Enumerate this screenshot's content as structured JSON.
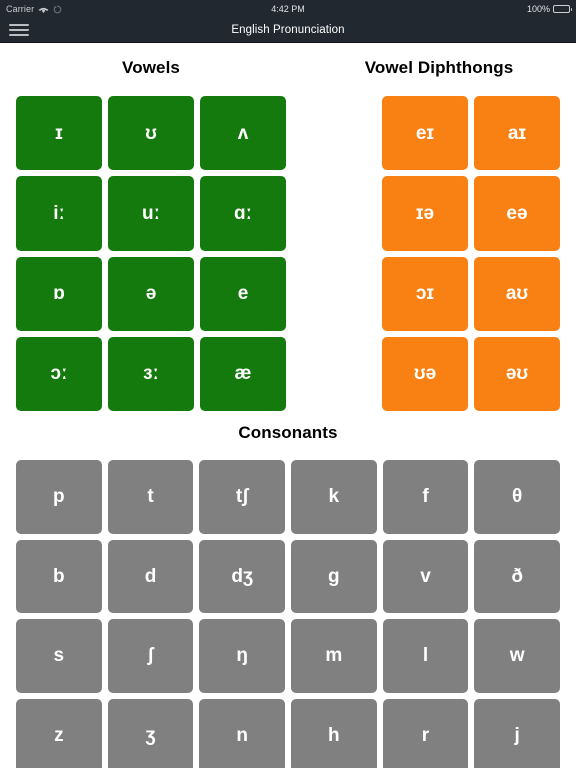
{
  "status_bar": {
    "carrier": "Carrier",
    "wifi_icon": "wifi-icon",
    "sync_icon": "sync-icon",
    "time": "4:42 PM",
    "battery_percent": "100%",
    "battery_icon": "battery-icon"
  },
  "nav_bar": {
    "menu_icon": "hamburger-menu-icon",
    "title": "English Pronunciation"
  },
  "sections": {
    "vowels": {
      "title": "Vowels",
      "color": "#157a0e",
      "columns": 3,
      "symbols": [
        "ɪ",
        "ʊ",
        "ʌ",
        "iː",
        "uː",
        "ɑː",
        "ɒ",
        "ə",
        "e",
        "ɔː",
        "ɜː",
        "æ"
      ]
    },
    "diphthongs": {
      "title": "Vowel Diphthongs",
      "color": "#f98012",
      "columns": 2,
      "symbols": [
        "eɪ",
        "aɪ",
        "ɪə",
        "eə",
        "ɔɪ",
        "aʊ",
        "ʊə",
        "əʊ"
      ]
    },
    "consonants": {
      "title": "Consonants",
      "color": "#808080",
      "columns": 6,
      "symbols": [
        "p",
        "t",
        "tʃ",
        "k",
        "f",
        "θ",
        "b",
        "d",
        "dʒ",
        "g",
        "v",
        "ð",
        "s",
        "ʃ",
        "ŋ",
        "m",
        "l",
        "w",
        "z",
        "ʒ",
        "n",
        "h",
        "r",
        "j"
      ]
    }
  }
}
